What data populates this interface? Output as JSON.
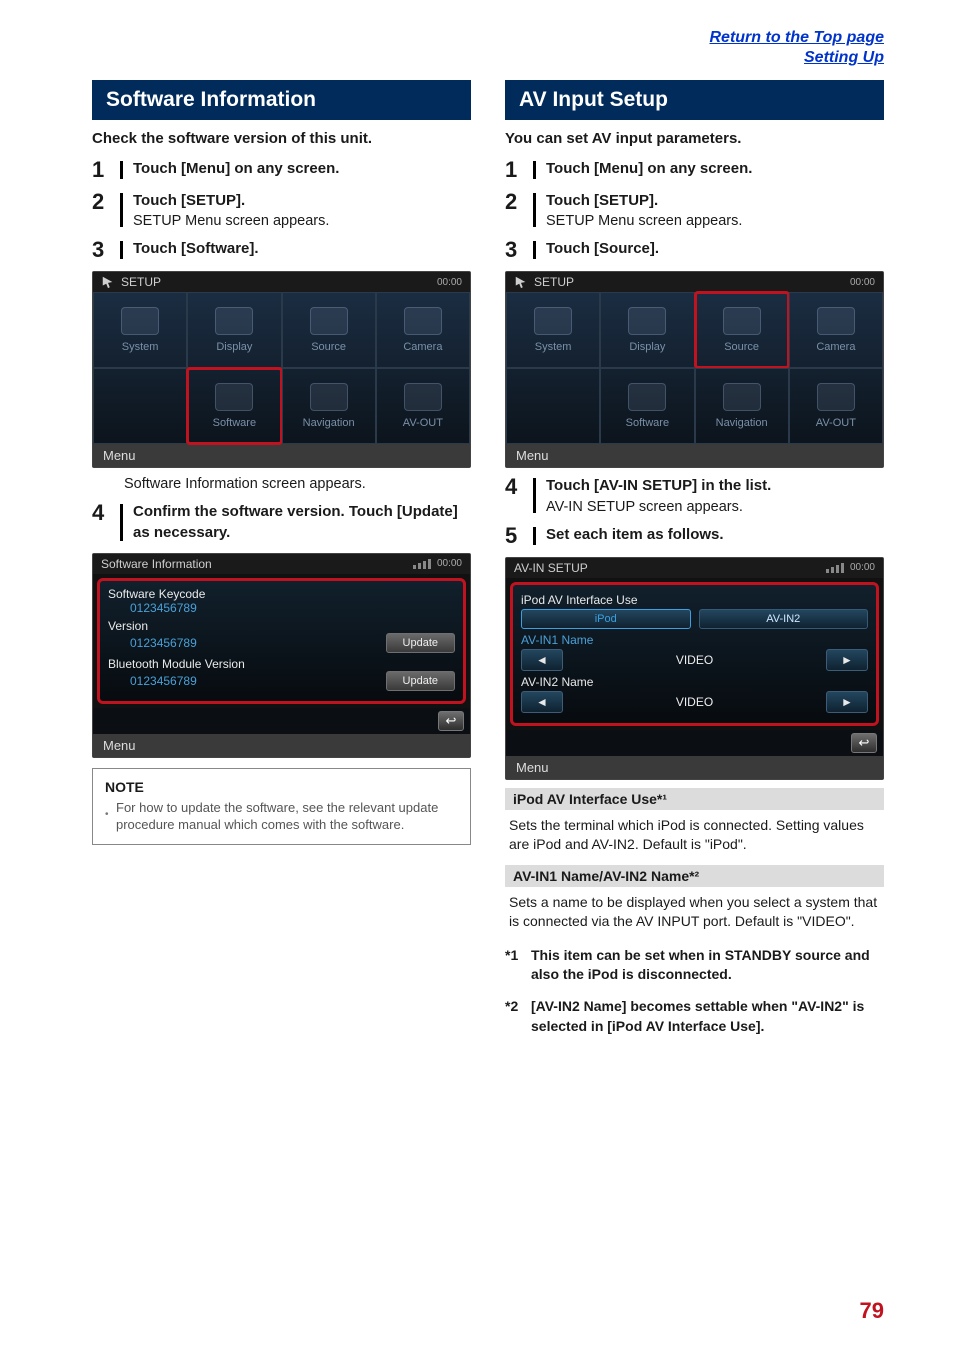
{
  "top_links": {
    "return": "Return to the Top page",
    "section": "Setting Up"
  },
  "page_number": "79",
  "left": {
    "section_title": "Software Information",
    "intro": "Check the software version of this unit.",
    "steps": {
      "s1": {
        "num": "1",
        "title": "Touch [Menu] on any screen."
      },
      "s2": {
        "num": "2",
        "title": "Touch [SETUP].",
        "sub": "SETUP Menu screen appears."
      },
      "s3": {
        "num": "3",
        "title": "Touch [Software]."
      },
      "s4": {
        "num": "4",
        "title": "Confirm the software version. Touch [Update] as necessary."
      }
    },
    "after_setup": "Software Information screen appears.",
    "setup_ss": {
      "title": "SETUP",
      "clock": "00:00",
      "items": [
        "System",
        "Display",
        "Source",
        "Camera",
        "Software",
        "Navigation",
        "AV-OUT"
      ],
      "highlight": "Software",
      "footer": "Menu"
    },
    "si_ss": {
      "title": "Software Information",
      "clock": "00:00",
      "keycode_label": "Software Keycode",
      "keycode_val": "0123456789",
      "version_label": "Version",
      "version_val": "0123456789",
      "update1": "Update",
      "bt_label": "Bluetooth Module Version",
      "bt_val": "0123456789",
      "update2": "Update",
      "footer": "Menu"
    },
    "note": {
      "title": "NOTE",
      "body": "For how to update the software, see the relevant update procedure manual which comes with the software."
    }
  },
  "right": {
    "section_title": "AV Input Setup",
    "intro": "You can set AV input parameters.",
    "steps": {
      "s1": {
        "num": "1",
        "title": "Touch [Menu] on any screen."
      },
      "s2": {
        "num": "2",
        "title": "Touch [SETUP].",
        "sub": "SETUP Menu screen appears."
      },
      "s3": {
        "num": "3",
        "title": "Touch [Source]."
      },
      "s4": {
        "num": "4",
        "title": "Touch [AV-IN SETUP] in the list.",
        "sub": "AV-IN SETUP screen appears."
      },
      "s5": {
        "num": "5",
        "title": "Set each item as follows."
      }
    },
    "setup_ss": {
      "title": "SETUP",
      "clock": "00:00",
      "items": [
        "System",
        "Display",
        "Source",
        "Camera",
        "Software",
        "Navigation",
        "AV-OUT"
      ],
      "highlight": "Source",
      "footer": "Menu"
    },
    "av_ss": {
      "title": "AV-IN SETUP",
      "clock": "00:00",
      "row1_label": "iPod AV Interface Use",
      "row1_opt1": "iPod",
      "row1_opt2": "AV-IN2",
      "row2_label": "AV-IN1 Name",
      "row2_val": "VIDEO",
      "row3_label": "AV-IN2 Name",
      "row3_val": "VIDEO",
      "footer": "Menu"
    },
    "settings": {
      "s1_title": "iPod AV Interface Use*¹",
      "s1_body": "Sets the terminal which iPod is connected. Setting values are iPod and AV-IN2. Default is \"iPod\".",
      "s2_title": "AV-IN1 Name/AV-IN2 Name*²",
      "s2_body": "Sets a name to be displayed when you select a system that is connected via the AV INPUT port. Default is \"VIDEO\"."
    },
    "foot": {
      "f1_tag": "*1",
      "f1_body": "This item can be set when in STANDBY source and also the iPod is disconnected.",
      "f2_tag": "*2",
      "f2_body": "[AV-IN2 Name] becomes settable when \"AV-IN2\" is selected in [iPod AV Interface Use]."
    }
  }
}
